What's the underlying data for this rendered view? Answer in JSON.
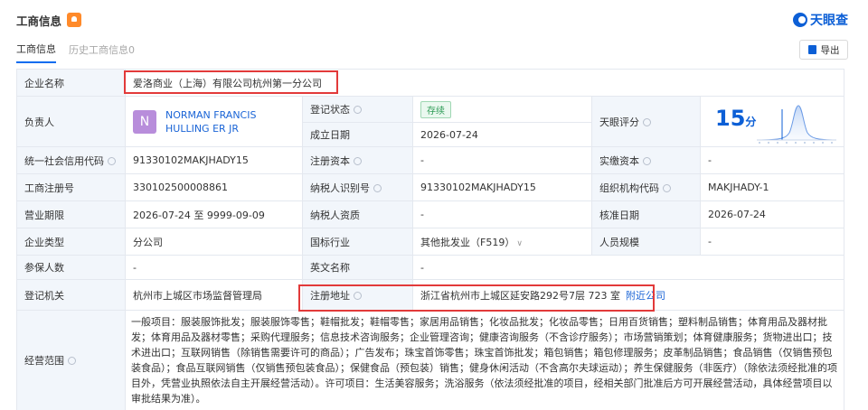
{
  "header": {
    "title": "工商信息",
    "logo_text": "天眼查"
  },
  "tabs": [
    {
      "label": "工商信息",
      "active": true
    },
    {
      "label": "历史工商信息0",
      "active": false
    }
  ],
  "export_label": "导出",
  "rows": {
    "company_name": {
      "label": "企业名称",
      "value": "爱洛商业（上海）有限公司杭州第一分公司"
    },
    "rep": {
      "label": "负责人",
      "avatar": "N",
      "name": "NORMAN FRANCIS HULLING ER JR"
    },
    "reg_status": {
      "label": "登记状态",
      "value": "存续"
    },
    "est_date": {
      "label": "成立日期",
      "value": "2026-07-24"
    },
    "score": {
      "label": "天眼评分",
      "value": "15",
      "unit": "分"
    },
    "credit_code": {
      "label": "统一社会信用代码",
      "value": "91330102MAKJHADY15"
    },
    "reg_capital": {
      "label": "注册资本",
      "value": "-"
    },
    "paid_capital": {
      "label": "实缴资本",
      "value": "-"
    },
    "reg_no": {
      "label": "工商注册号",
      "value": "330102500008861"
    },
    "tax_id": {
      "label": "纳税人识别号",
      "value": "91330102MAKJHADY15"
    },
    "org_code": {
      "label": "组织机构代码",
      "value": "MAKJHADY-1"
    },
    "term": {
      "label": "营业期限",
      "value": "2026-07-24 至 9999-09-09"
    },
    "tax_qual": {
      "label": "纳税人资质",
      "value": "-"
    },
    "approve_date": {
      "label": "核准日期",
      "value": "2026-07-24"
    },
    "type": {
      "label": "企业类型",
      "value": "分公司"
    },
    "industry": {
      "label": "国标行业",
      "value": "其他批发业（F519）"
    },
    "staff": {
      "label": "人员规模",
      "value": "-"
    },
    "insured": {
      "label": "参保人数",
      "value": "-"
    },
    "en_name": {
      "label": "英文名称",
      "value": "-"
    },
    "authority": {
      "label": "登记机关",
      "value": "杭州市上城区市场监督管理局"
    },
    "address": {
      "label": "注册地址",
      "value": "浙江省杭州市上城区延安路292号7层 723 室",
      "link": "附近公司"
    },
    "scope": {
      "label": "经营范围",
      "value": "一般项目：服装服饰批发；服装服饰零售；鞋帽批发；鞋帽零售；家居用品销售；化妆品批发；化妆品零售；日用百货销售；塑料制品销售；体育用品及器材批发；体育用品及器材零售；采购代理服务；信息技术咨询服务；企业管理咨询；健康咨询服务（不含诊疗服务）；市场营销策划；体育健康服务；货物进出口；技术进出口；互联网销售（除销售需要许可的商品）；广告发布；珠宝首饰零售；珠宝首饰批发；箱包销售；箱包修理服务；皮革制品销售；食品销售（仅销售预包装食品）；食品互联网销售（仅销售预包装食品）；保健食品（预包装）销售；健身休闲活动（不含高尔夫球运动）；养生保健服务（非医疗）（除依法须经批准的项目外，凭营业执照依法自主开展经营活动）。许可项目：生活美容服务；洗浴服务（依法须经批准的项目，经相关部门批准后方可开展经营活动，具体经营项目以审批结果为准）。"
    }
  },
  "colors": {
    "accent": "#0c5fd6",
    "label_bg": "#f2f6fb",
    "highlight": "#e23a3a",
    "status_green": "#2e9b56"
  },
  "icons": [
    "bell-icon",
    "logo-icon",
    "export-icon",
    "info-hint-icon",
    "chevron-down-icon",
    "score-distribution-chart"
  ]
}
